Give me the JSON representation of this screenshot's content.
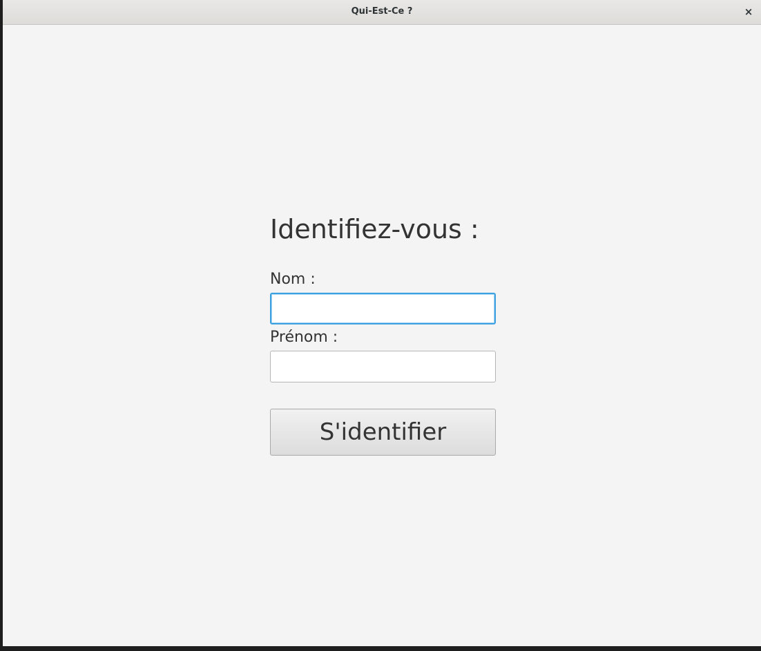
{
  "window": {
    "title": "Qui-Est-Ce ?",
    "close_glyph": "×"
  },
  "form": {
    "heading": "Identifiez-vous :",
    "last_name": {
      "label": "Nom :",
      "value": "",
      "focused": true
    },
    "first_name": {
      "label": "Prénom :",
      "value": ""
    },
    "submit_label": "S'identifier"
  },
  "colors": {
    "background": "#f4f4f4",
    "text": "#333333",
    "focus_border": "#3aa0e0"
  },
  "icons": {
    "close": "close-icon"
  }
}
